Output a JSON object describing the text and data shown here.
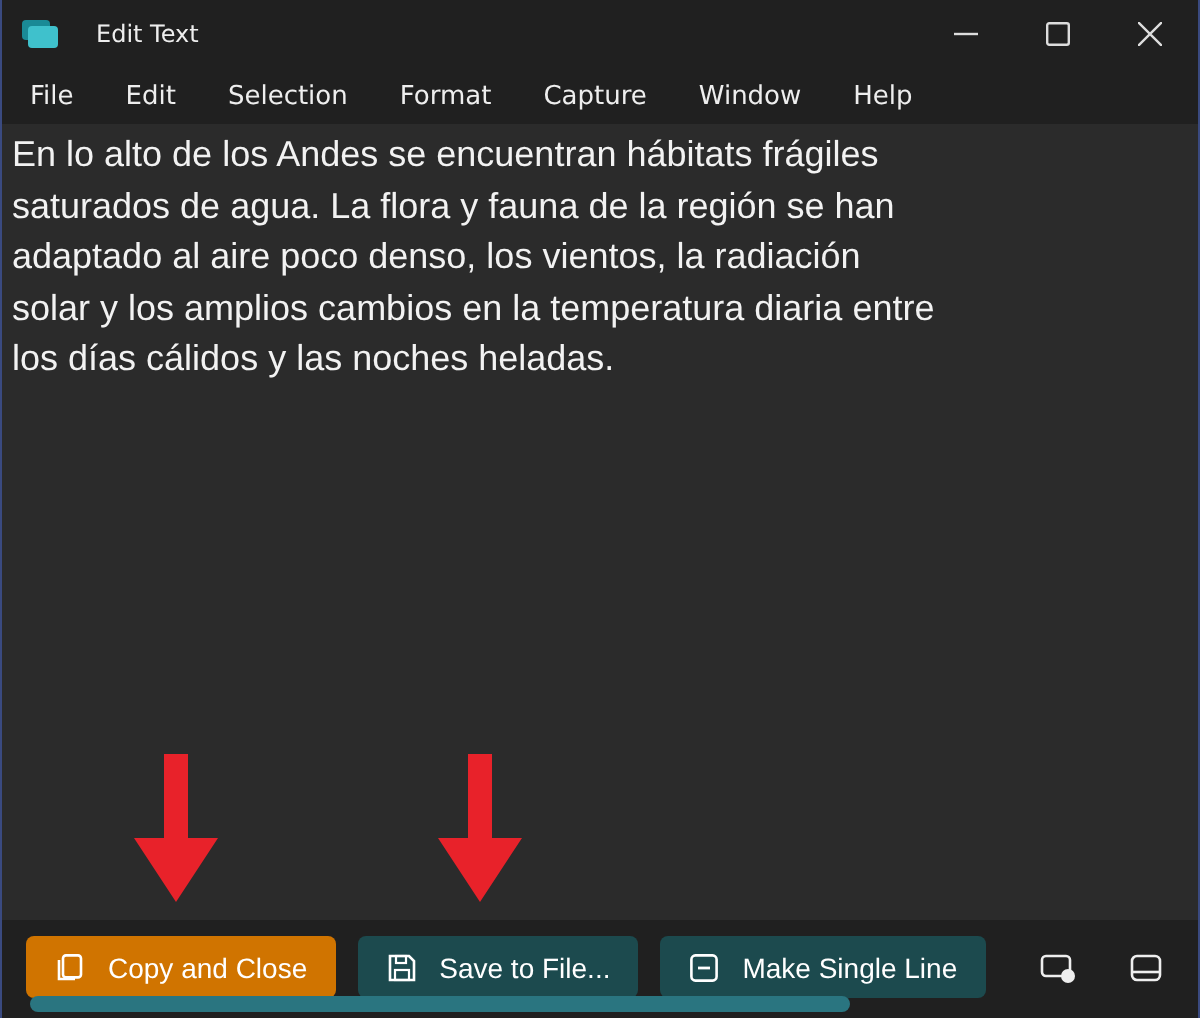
{
  "window": {
    "title": "Edit Text"
  },
  "menu": [
    "File",
    "Edit",
    "Selection",
    "Format",
    "Capture",
    "Window",
    "Help"
  ],
  "text": "En lo alto de los Andes se encuentran hábitats frágiles saturados de agua. La flora y fauna de la región se han adaptado al aire poco denso, los vientos, la radiación solar y los amplios cambios en la temperatura diaria entre los días cálidos y las noches heladas.",
  "buttons": [
    {
      "label": "Copy and Close",
      "kind": "copy",
      "primary": true
    },
    {
      "label": "Save to File...",
      "kind": "save",
      "primary": false
    },
    {
      "label": "Make Single Line",
      "kind": "single",
      "primary": false
    }
  ],
  "scrollbar": {
    "level": 0.72
  }
}
